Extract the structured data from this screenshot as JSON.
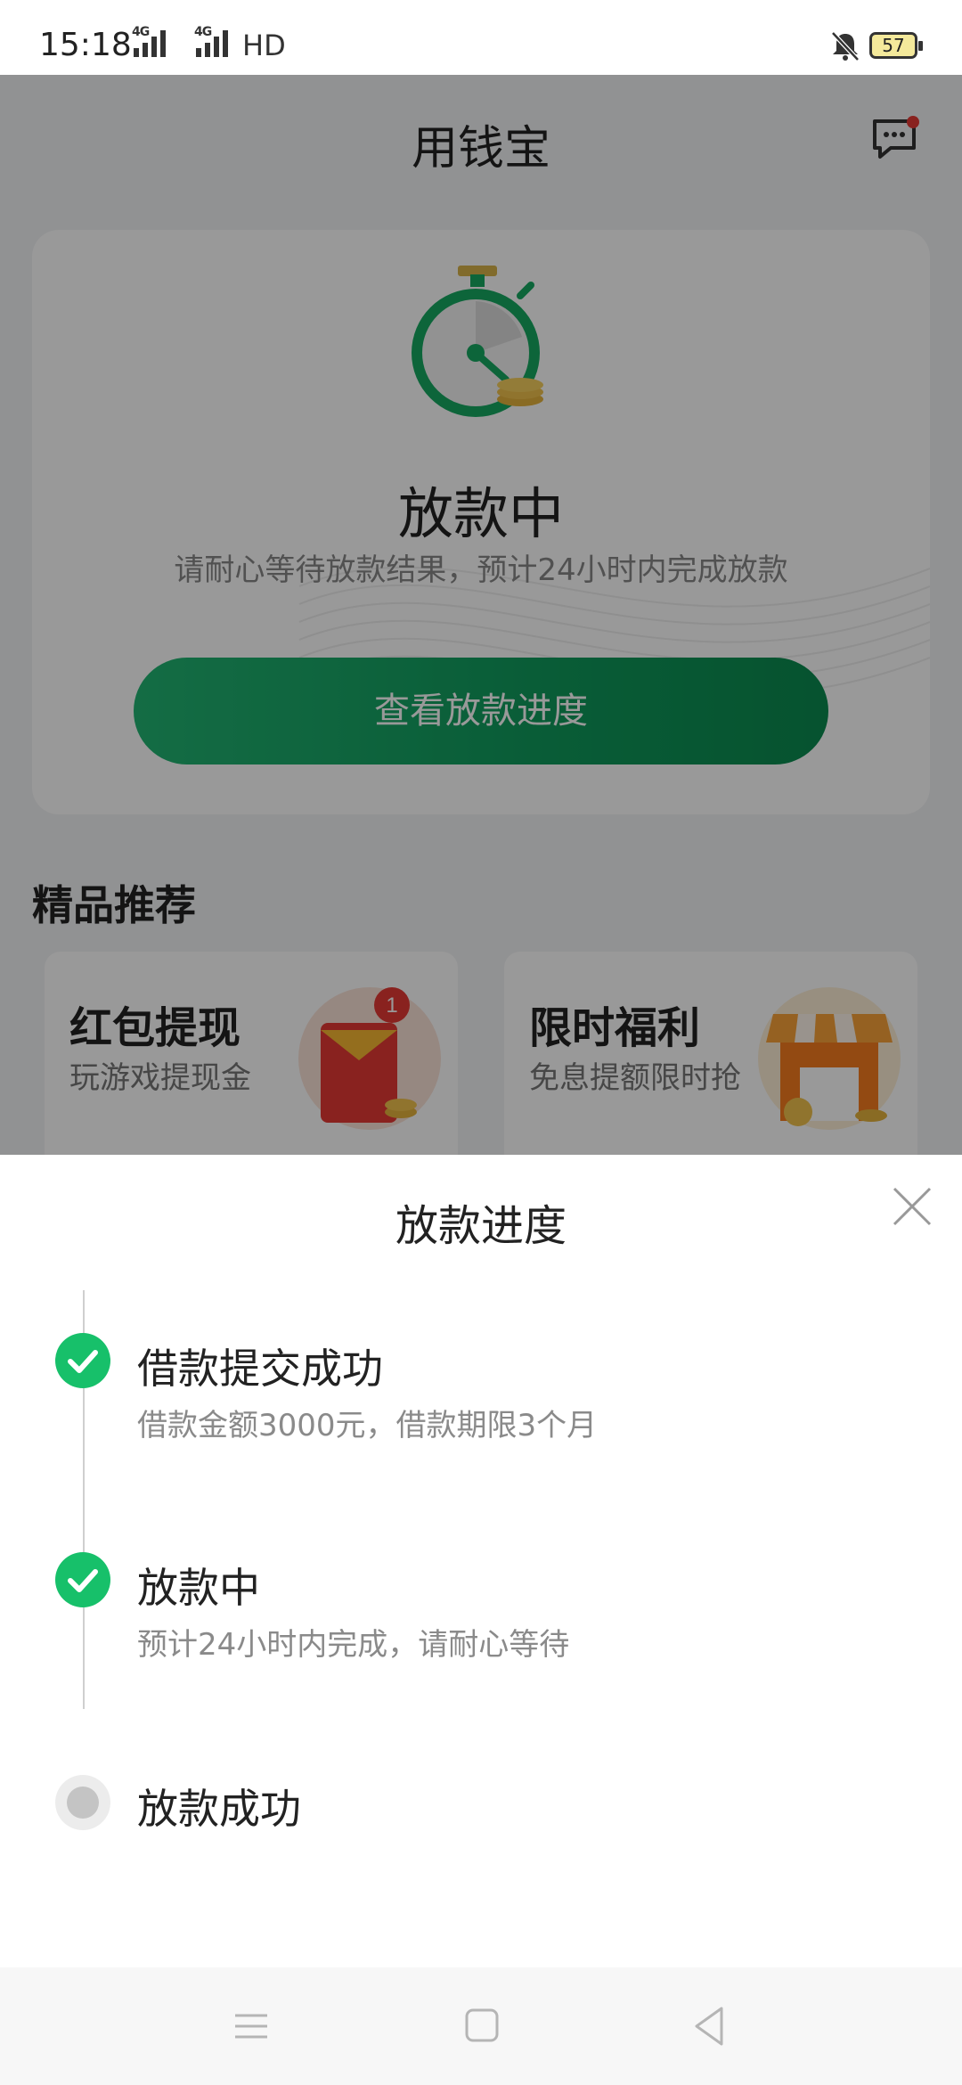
{
  "status_bar": {
    "time": "15:18",
    "signal1": "4G",
    "signal2": "4G",
    "hd_label": "HD",
    "battery": "57",
    "icons": [
      "signal-icon",
      "signal-icon",
      "mute-bell-icon",
      "battery-icon"
    ]
  },
  "app": {
    "title": "用钱宝",
    "message_icon": "chat-bubble-icon",
    "hero": {
      "status": "放款中",
      "description": "请耐心等待放款结果，预计24小时内完成放款",
      "button_label": "查看放款进度",
      "icon": "stopwatch-icon"
    },
    "section_title": "精品推荐",
    "promos": [
      {
        "title": "红包提现",
        "subtitle": "玩游戏提现金",
        "icon": "red-envelope-icon",
        "badge": "1"
      },
      {
        "title": "限时福利",
        "subtitle": "免息提额限时抢",
        "icon": "shop-icon"
      }
    ]
  },
  "sheet": {
    "title": "放款进度",
    "close_icon": "close-icon",
    "steps": [
      {
        "title": "借款提交成功",
        "desc": "借款金额3000元，借款期限3个月",
        "state": "done"
      },
      {
        "title": "放款中",
        "desc": "预计24小时内完成，请耐心等待",
        "state": "done"
      },
      {
        "title": "放款成功",
        "desc": "",
        "state": "pending"
      }
    ]
  },
  "nav": {
    "icons": [
      "menu-icon",
      "home-square-icon",
      "back-triangle-icon"
    ]
  },
  "colors": {
    "accent_green": "#17c06a",
    "button_green": "#0f9a5c",
    "badge_red": "#e53935"
  }
}
